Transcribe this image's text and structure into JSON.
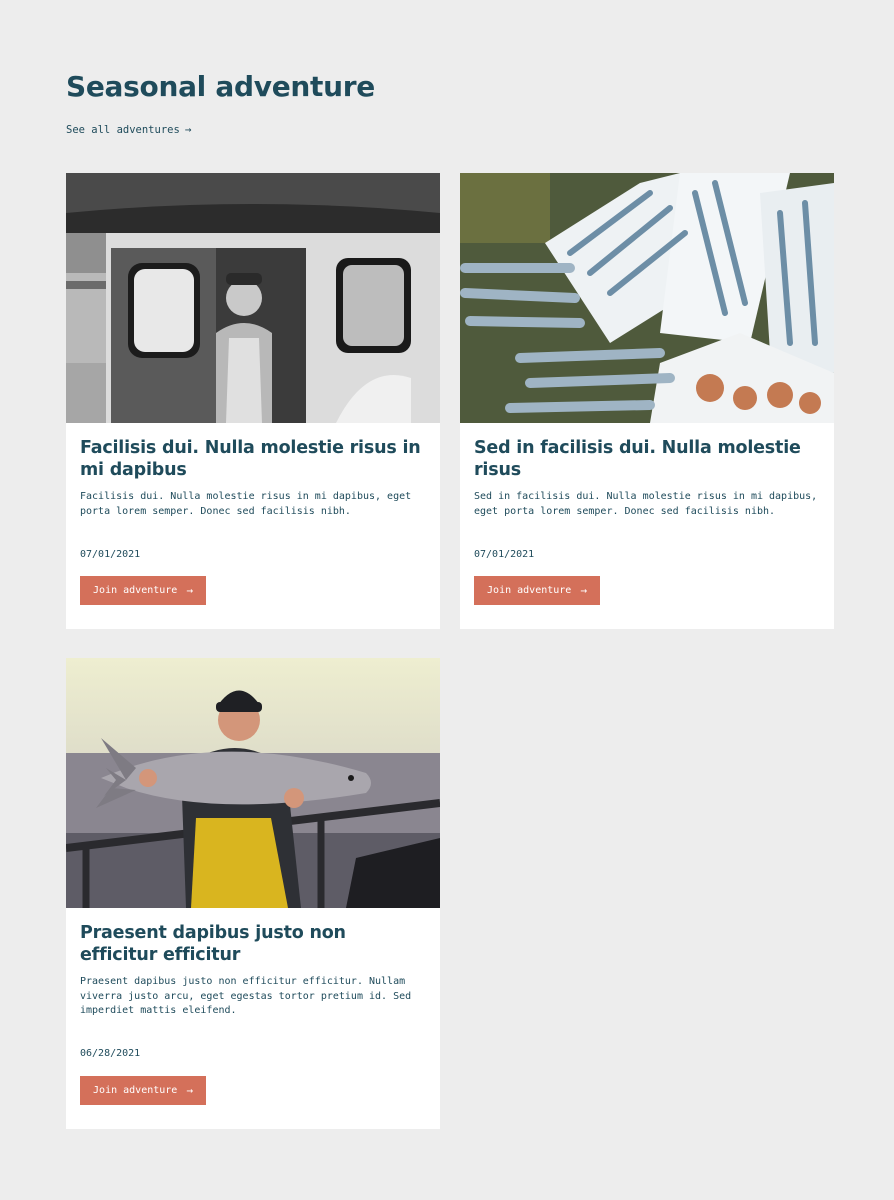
{
  "section": {
    "title": "Seasonal adventure",
    "see_all_label": "See all adventures",
    "arrow": "→"
  },
  "cards": [
    {
      "image": "fisherman-on-boat-photo",
      "title": "Facilisis dui. Nulla molestie risus in mi dapibus",
      "description": "Facilisis dui. Nulla molestie risus in mi dapibus, eget porta lorem semper. Donec sed facilisis nibh.",
      "date": "07/01/2021",
      "button_label": "Join adventure"
    },
    {
      "image": "fish-crates-photo",
      "title": "Sed in facilisis dui. Nulla molestie risus",
      "description": "Sed in facilisis dui. Nulla molestie risus in mi dapibus, eget porta lorem semper. Donec sed facilisis nibh.",
      "date": "07/01/2021",
      "button_label": "Join adventure"
    },
    {
      "image": "fisherman-holding-salmon-photo",
      "title": "Praesent dapibus justo non efficitur efficitur",
      "description": "Praesent dapibus justo non efficitur efficitur. Nullam viverra justo arcu, eget egestas tortor pretium id. Sed imperdiet mattis eleifend.",
      "date": "06/28/2021",
      "button_label": "Join adventure"
    }
  ],
  "colors": {
    "background": "#ededed",
    "heading": "#1f4b5b",
    "button": "#d4705a",
    "card": "#ffffff"
  }
}
